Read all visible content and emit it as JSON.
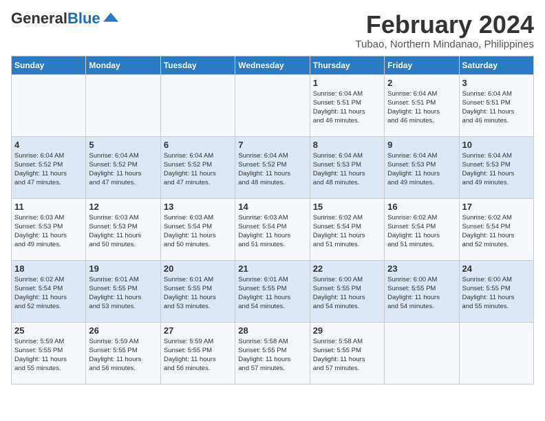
{
  "header": {
    "logo_general": "General",
    "logo_blue": "Blue",
    "month_year": "February 2024",
    "location": "Tubao, Northern Mindanao, Philippines"
  },
  "weekdays": [
    "Sunday",
    "Monday",
    "Tuesday",
    "Wednesday",
    "Thursday",
    "Friday",
    "Saturday"
  ],
  "weeks": [
    [
      {
        "day": "",
        "info": ""
      },
      {
        "day": "",
        "info": ""
      },
      {
        "day": "",
        "info": ""
      },
      {
        "day": "",
        "info": ""
      },
      {
        "day": "1",
        "info": "Sunrise: 6:04 AM\nSunset: 5:51 PM\nDaylight: 11 hours\nand 46 minutes."
      },
      {
        "day": "2",
        "info": "Sunrise: 6:04 AM\nSunset: 5:51 PM\nDaylight: 11 hours\nand 46 minutes."
      },
      {
        "day": "3",
        "info": "Sunrise: 6:04 AM\nSunset: 5:51 PM\nDaylight: 11 hours\nand 46 minutes."
      }
    ],
    [
      {
        "day": "4",
        "info": "Sunrise: 6:04 AM\nSunset: 5:52 PM\nDaylight: 11 hours\nand 47 minutes."
      },
      {
        "day": "5",
        "info": "Sunrise: 6:04 AM\nSunset: 5:52 PM\nDaylight: 11 hours\nand 47 minutes."
      },
      {
        "day": "6",
        "info": "Sunrise: 6:04 AM\nSunset: 5:52 PM\nDaylight: 11 hours\nand 47 minutes."
      },
      {
        "day": "7",
        "info": "Sunrise: 6:04 AM\nSunset: 5:52 PM\nDaylight: 11 hours\nand 48 minutes."
      },
      {
        "day": "8",
        "info": "Sunrise: 6:04 AM\nSunset: 5:53 PM\nDaylight: 11 hours\nand 48 minutes."
      },
      {
        "day": "9",
        "info": "Sunrise: 6:04 AM\nSunset: 5:53 PM\nDaylight: 11 hours\nand 49 minutes."
      },
      {
        "day": "10",
        "info": "Sunrise: 6:04 AM\nSunset: 5:53 PM\nDaylight: 11 hours\nand 49 minutes."
      }
    ],
    [
      {
        "day": "11",
        "info": "Sunrise: 6:03 AM\nSunset: 5:53 PM\nDaylight: 11 hours\nand 49 minutes."
      },
      {
        "day": "12",
        "info": "Sunrise: 6:03 AM\nSunset: 5:53 PM\nDaylight: 11 hours\nand 50 minutes."
      },
      {
        "day": "13",
        "info": "Sunrise: 6:03 AM\nSunset: 5:54 PM\nDaylight: 11 hours\nand 50 minutes."
      },
      {
        "day": "14",
        "info": "Sunrise: 6:03 AM\nSunset: 5:54 PM\nDaylight: 11 hours\nand 51 minutes."
      },
      {
        "day": "15",
        "info": "Sunrise: 6:02 AM\nSunset: 5:54 PM\nDaylight: 11 hours\nand 51 minutes."
      },
      {
        "day": "16",
        "info": "Sunrise: 6:02 AM\nSunset: 5:54 PM\nDaylight: 11 hours\nand 51 minutes."
      },
      {
        "day": "17",
        "info": "Sunrise: 6:02 AM\nSunset: 5:54 PM\nDaylight: 11 hours\nand 52 minutes."
      }
    ],
    [
      {
        "day": "18",
        "info": "Sunrise: 6:02 AM\nSunset: 5:54 PM\nDaylight: 11 hours\nand 52 minutes."
      },
      {
        "day": "19",
        "info": "Sunrise: 6:01 AM\nSunset: 5:55 PM\nDaylight: 11 hours\nand 53 minutes."
      },
      {
        "day": "20",
        "info": "Sunrise: 6:01 AM\nSunset: 5:55 PM\nDaylight: 11 hours\nand 53 minutes."
      },
      {
        "day": "21",
        "info": "Sunrise: 6:01 AM\nSunset: 5:55 PM\nDaylight: 11 hours\nand 54 minutes."
      },
      {
        "day": "22",
        "info": "Sunrise: 6:00 AM\nSunset: 5:55 PM\nDaylight: 11 hours\nand 54 minutes."
      },
      {
        "day": "23",
        "info": "Sunrise: 6:00 AM\nSunset: 5:55 PM\nDaylight: 11 hours\nand 54 minutes."
      },
      {
        "day": "24",
        "info": "Sunrise: 6:00 AM\nSunset: 5:55 PM\nDaylight: 11 hours\nand 55 minutes."
      }
    ],
    [
      {
        "day": "25",
        "info": "Sunrise: 5:59 AM\nSunset: 5:55 PM\nDaylight: 11 hours\nand 55 minutes."
      },
      {
        "day": "26",
        "info": "Sunrise: 5:59 AM\nSunset: 5:55 PM\nDaylight: 11 hours\nand 56 minutes."
      },
      {
        "day": "27",
        "info": "Sunrise: 5:59 AM\nSunset: 5:55 PM\nDaylight: 11 hours\nand 56 minutes."
      },
      {
        "day": "28",
        "info": "Sunrise: 5:58 AM\nSunset: 5:55 PM\nDaylight: 11 hours\nand 57 minutes."
      },
      {
        "day": "29",
        "info": "Sunrise: 5:58 AM\nSunset: 5:55 PM\nDaylight: 11 hours\nand 57 minutes."
      },
      {
        "day": "",
        "info": ""
      },
      {
        "day": "",
        "info": ""
      }
    ]
  ]
}
